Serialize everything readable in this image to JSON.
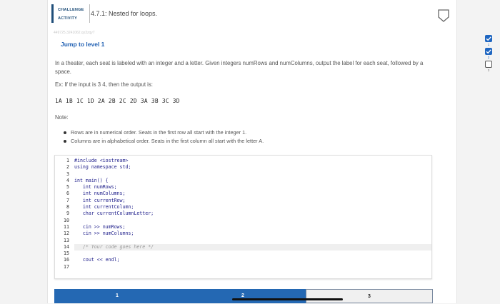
{
  "header": {
    "badge_line1": "CHALLENGE",
    "badge_line2": "ACTIVITY",
    "title": "4.7.1: Nested for loops."
  },
  "activity_code": "449725.3241062.qx3zqy7",
  "jump_label": "Jump to level 1",
  "problem": {
    "description": "In a theater, each seat is labeled with an integer and a letter. Given integers numRows and numColumns, output the label for each seat, followed by a space.",
    "example": "Ex: If the input is 3 4, then the output is:",
    "output": "1A 1B 1C 1D 2A 2B 2C 2D 3A 3B 3C 3D",
    "note_label": "Note:",
    "notes": [
      "Rows are in numerical order. Seats in the first row all start with the integer 1.",
      "Columns are in alphabetical order. Seats in the first column all start with the letter A."
    ]
  },
  "editor": {
    "active_line": 14,
    "lines": [
      "#include <iostream>",
      "using namespace std;",
      "",
      "int main() {",
      "   int numRows;",
      "   int numColumns;",
      "   int currentRow;",
      "   int currentColumn;",
      "   char currentColumnLetter;",
      "",
      "   cin >> numRows;",
      "   cin >> numColumns;",
      "",
      "   /* Your code goes here */",
      "",
      "   cout << endl;",
      ""
    ]
  },
  "progress": {
    "levels": [
      "1",
      "2",
      "3"
    ],
    "completed": 2,
    "current": 3
  },
  "sidebar": {
    "levels": [
      {
        "num": "1",
        "status": "complete"
      },
      {
        "num": "2",
        "status": "complete"
      },
      {
        "num": "3",
        "status": "incomplete"
      }
    ]
  },
  "colors": {
    "accent": "#2468b3",
    "badge": "#1f4e79",
    "link": "#1f5fb2"
  },
  "icons": {
    "header": "shield-outline-icon",
    "level_complete": "checkmark-icon"
  }
}
